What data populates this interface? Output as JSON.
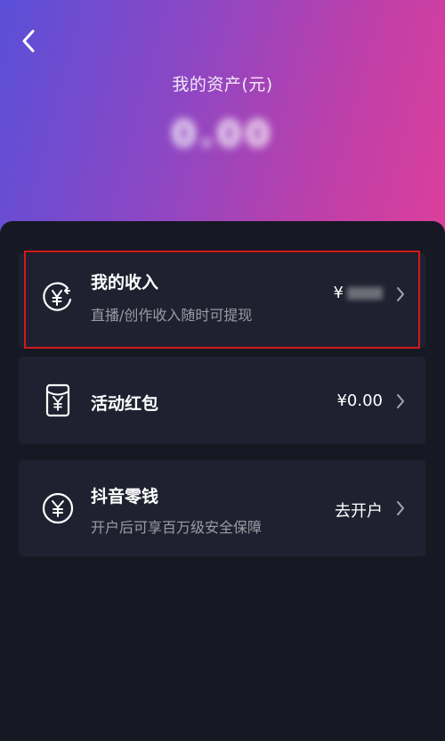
{
  "header": {
    "title": "我的资产(元)",
    "amount": "0.00"
  },
  "cards": {
    "income": {
      "title": "我的收入",
      "subtitle": "直播/创作收入随时可提现",
      "value_prefix": "¥",
      "icon": "yen-income-icon"
    },
    "red_packet": {
      "title": "活动红包",
      "value": "¥0.00",
      "icon": "red-packet-icon"
    },
    "wallet": {
      "title": "抖音零钱",
      "subtitle": "开户后可享百万级安全保障",
      "value": "去开户",
      "icon": "yen-circle-icon"
    }
  },
  "colors": {
    "header_gradient_start": "#5a4fd8",
    "header_gradient_end": "#dd3f9b",
    "background": "#161823",
    "card_background": "#1f2130",
    "highlight_border": "#d11a1a"
  }
}
